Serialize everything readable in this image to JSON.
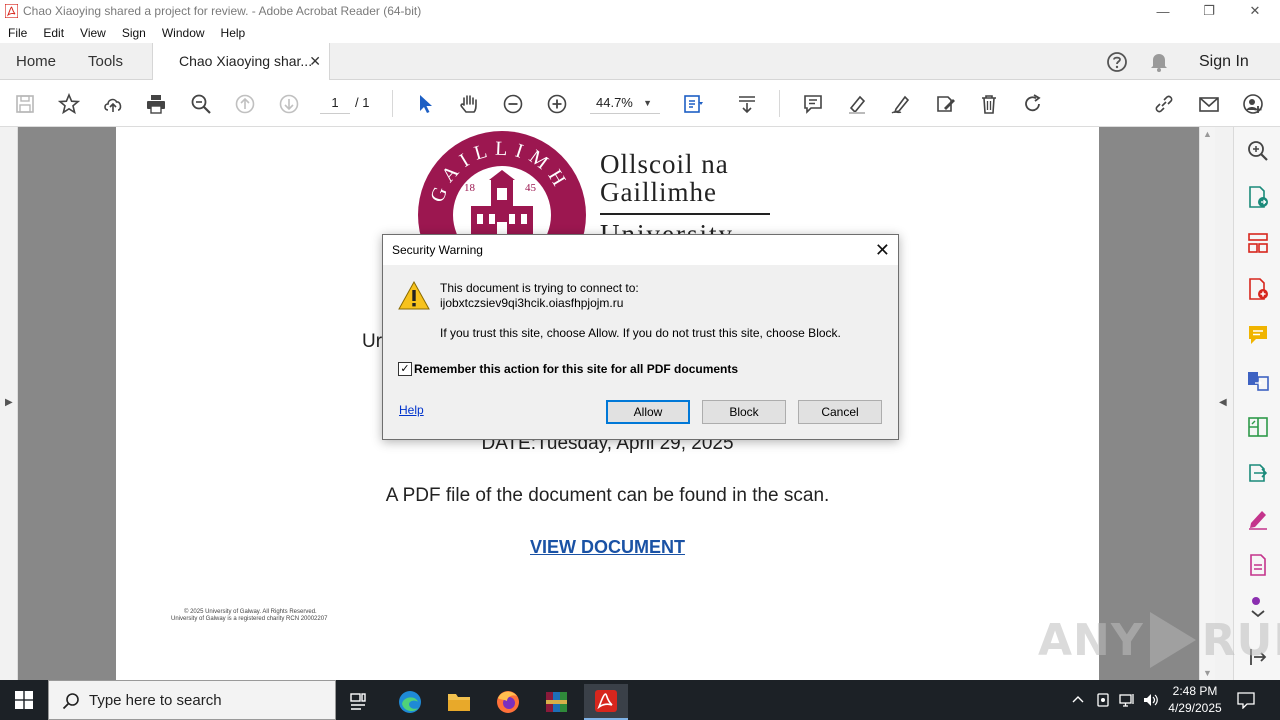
{
  "window": {
    "title": "Chao Xiaoying shared a project for review. - Adobe Acrobat Reader (64-bit)",
    "minimize_label": "—",
    "restore_label": "❐",
    "close_label": "✕"
  },
  "menu": [
    "File",
    "Edit",
    "View",
    "Sign",
    "Window",
    "Help"
  ],
  "tabs": {
    "home": "Home",
    "tools": "Tools",
    "document": "Chao Xiaoying shar...",
    "close": "✕"
  },
  "header": {
    "help_icon": "?",
    "sign_in": "Sign In"
  },
  "toolbar": {
    "page_current": "1",
    "page_total": "/ 1",
    "zoom": "44.7%",
    "zoom_chevron": "▼"
  },
  "document": {
    "logo_line1": "Ollscoil na",
    "logo_line2": "Gaillimhe",
    "logo_line3": "University",
    "crest_year_left": "18",
    "crest_year_right": "45",
    "crest_ring_text": "GAILLIMH",
    "partial_text": "Ur",
    "date_line": "DATE:Tuesday, April 29, 2025",
    "found_line": "A PDF file of the document can be found in the scan.",
    "view_document": "VIEW DOCUMENT",
    "footer_line1": "© 2025 University of Galway. All Rights Reserved.",
    "footer_line2": "University of Galway is a registered charity RCN 20002207"
  },
  "dialog": {
    "title": "Security Warning",
    "close": "✕",
    "message_line1": "This document is trying to connect to:",
    "message_host": "ijobxtczsiev9qi3hcik.oiasfhpjojm.ru",
    "trust_text": "If you trust this site, choose Allow. If you do not trust this site, choose Block.",
    "checkbox_checked": true,
    "checkbox_mark": "✓",
    "checkbox_label": "Remember this action for this site for all PDF documents",
    "help_link": "Help",
    "allow": "Allow",
    "block": "Block",
    "cancel": "Cancel"
  },
  "panels": {
    "left_arrow": "▶",
    "right_arrow": "◀",
    "scroll_up": "▲",
    "scroll_down": "▼"
  },
  "watermark": {
    "left": "ANY",
    "right": "RUN"
  },
  "taskbar": {
    "search_placeholder": "Type here to search",
    "time": "2:48 PM",
    "date": "4/29/2025"
  },
  "colors": {
    "crest": "#9c1750",
    "link": "#1a52a5",
    "taskbar": "#1c2126",
    "acrobat_red": "#d7261d",
    "dialog_primary": "#0078d7"
  }
}
